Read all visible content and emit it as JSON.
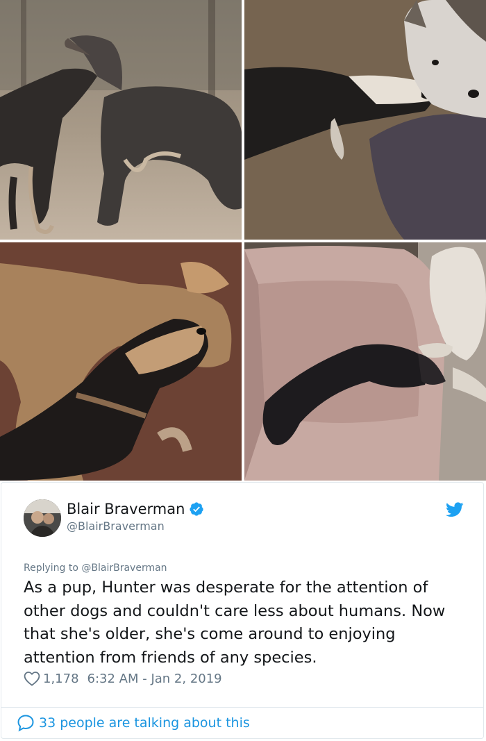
{
  "photos": [
    {
      "name": "two-dogs-playing-outdoors"
    },
    {
      "name": "dog-with-husky-on-bed"
    },
    {
      "name": "puppy-cuddling-dog"
    },
    {
      "name": "dog-sleeping-on-dog-bed"
    }
  ],
  "tweet": {
    "display_name": "Blair Braverman",
    "handle": "@BlairBraverman",
    "reply_prefix": "Replying to",
    "reply_mention": "@BlairBraverman",
    "text": "As a pup, Hunter was desperate for the attention of other dogs and couldn't care less about humans. Now that she's older, she's come around to enjoying attention from friends of any species.",
    "likes": "1,178",
    "timestamp": "6:32 AM - Jan 2, 2019",
    "talking": "33 people are talking about this"
  },
  "colors": {
    "twitter_blue": "#1da1f2",
    "link_blue": "#1b95e0",
    "secondary_text": "#657786",
    "primary_text": "#14171a"
  },
  "icons": [
    "verified-badge-icon",
    "twitter-bird-icon",
    "heart-icon",
    "speech-bubble-icon"
  ]
}
